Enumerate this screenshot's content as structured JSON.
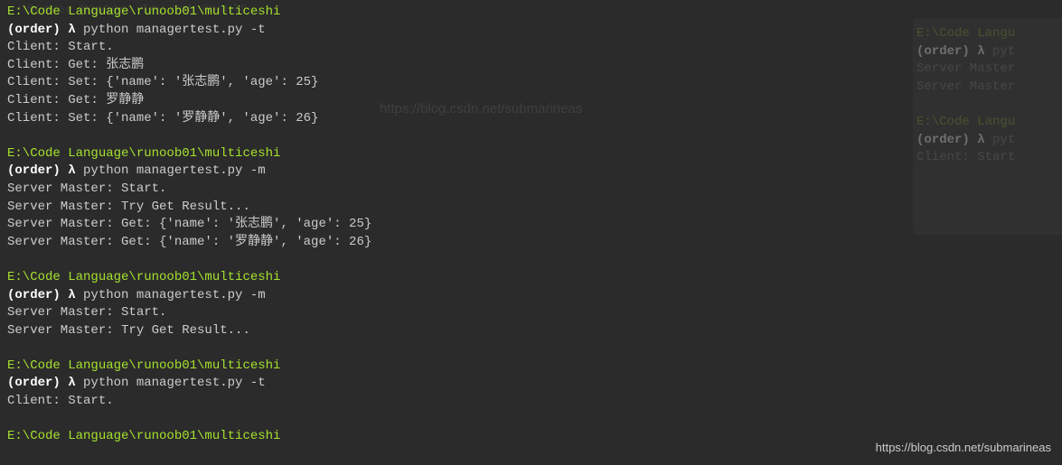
{
  "faded_top": "Server Master: Try Get Result...",
  "blocks": [
    {
      "path": "E:\\Code Language\\runoob01\\multiceshi",
      "prompt_env": "(order)",
      "lambda": "λ",
      "command": "python managertest.py -t",
      "output": [
        "Client: Start.",
        "Client: Get: 张志鹏",
        "Client: Set: {'name': '张志鹏', 'age': 25}",
        "Client: Get: 罗静静",
        "Client: Set: {'name': '罗静静', 'age': 26}"
      ]
    },
    {
      "path": "E:\\Code Language\\runoob01\\multiceshi",
      "prompt_env": "(order)",
      "lambda": "λ",
      "command": "python managertest.py -m",
      "output": [
        "Server Master: Start.",
        "Server Master: Try Get Result...",
        "Server Master: Get: {'name': '张志鹏', 'age': 25}",
        "Server Master: Get: {'name': '罗静静', 'age': 26}"
      ]
    },
    {
      "path": "E:\\Code Language\\runoob01\\multiceshi",
      "prompt_env": "(order)",
      "lambda": "λ",
      "command": "python managertest.py -m",
      "output": [
        "Server Master: Start.",
        "Server Master: Try Get Result..."
      ]
    },
    {
      "path": "E:\\Code Language\\runoob01\\multiceshi",
      "prompt_env": "(order)",
      "lambda": "λ",
      "command": "python managertest.py -t",
      "output": [
        "Client: Start."
      ]
    },
    {
      "path": "E:\\Code Language\\runoob01\\multiceshi",
      "prompt_env": "",
      "lambda": "",
      "command": "",
      "output": []
    }
  ],
  "ghost_panel": {
    "lines": [
      {
        "type": "path",
        "text": "E:\\Code Langu"
      },
      {
        "type": "prompt",
        "env": "(order)",
        "lambda": "λ",
        "cmd": "pyt"
      },
      {
        "type": "out",
        "text": "Server Master"
      },
      {
        "type": "out",
        "text": "Server Master"
      },
      {
        "type": "blank",
        "text": ""
      },
      {
        "type": "path",
        "text": "E:\\Code Langu"
      },
      {
        "type": "prompt",
        "env": "(order)",
        "lambda": "λ",
        "cmd": "pyt"
      },
      {
        "type": "out",
        "text": "Client: Start"
      }
    ]
  },
  "watermark_center": "https://blog.csdn.net/submarineas",
  "watermark_br": "https://blog.csdn.net/submarineas"
}
